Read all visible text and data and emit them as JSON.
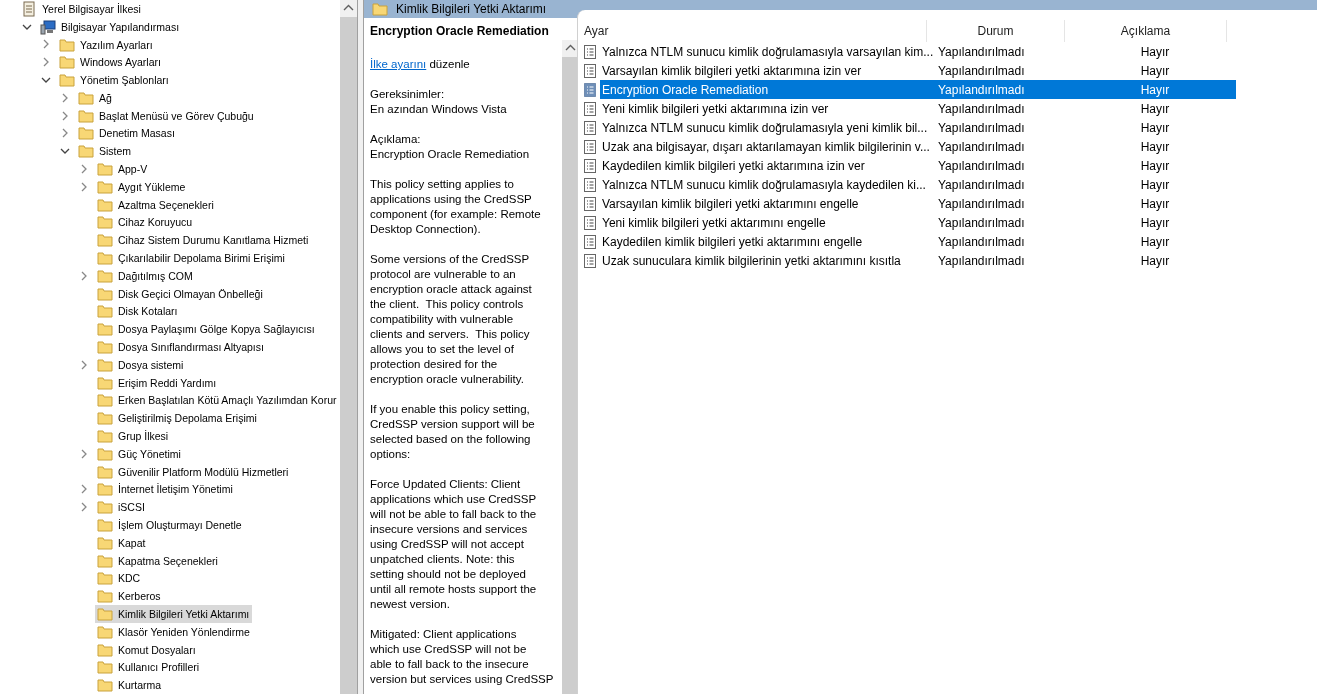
{
  "tree": [
    {
      "label": "Yerel Bilgisayar İlkesi",
      "kind": "policy",
      "selected": false,
      "children": [
        {
          "label": "Bilgisayar Yapılandırması",
          "kind": "computer",
          "expanded": true,
          "selected": false,
          "children": [
            {
              "label": "Yazılım Ayarları",
              "kind": "folder",
              "expanded": false,
              "selected": false
            },
            {
              "label": "Windows Ayarları",
              "kind": "folder",
              "expanded": false,
              "selected": false
            },
            {
              "label": "Yönetim Şablonları",
              "kind": "folder",
              "expanded": true,
              "selected": false,
              "children": [
                {
                  "label": "Ağ",
                  "kind": "folder",
                  "expanded": false,
                  "selected": false
                },
                {
                  "label": "Başlat Menüsü ve Görev Çubuğu",
                  "kind": "folder",
                  "expanded": false,
                  "selected": false
                },
                {
                  "label": "Denetim Masası",
                  "kind": "folder",
                  "expanded": false,
                  "selected": false
                },
                {
                  "label": "Sistem",
                  "kind": "folder",
                  "expanded": true,
                  "selected": false,
                  "children": [
                    {
                      "label": "App-V",
                      "kind": "folder",
                      "expanded": false,
                      "selected": false
                    },
                    {
                      "label": "Aygıt Yükleme",
                      "kind": "folder",
                      "expanded": false,
                      "selected": false
                    },
                    {
                      "label": "Azaltma Seçenekleri",
                      "kind": "folder",
                      "selected": false
                    },
                    {
                      "label": "Cihaz Koruyucu",
                      "kind": "folder",
                      "selected": false
                    },
                    {
                      "label": "Cihaz Sistem Durumu Kanıtlama Hizmeti",
                      "kind": "folder",
                      "selected": false
                    },
                    {
                      "label": "Çıkarılabilir Depolama Birimi Erişimi",
                      "kind": "folder",
                      "selected": false
                    },
                    {
                      "label": "Dağıtılmış COM",
                      "kind": "folder",
                      "expanded": false,
                      "selected": false
                    },
                    {
                      "label": "Disk Geçici Olmayan Önbelleği",
                      "kind": "folder",
                      "selected": false
                    },
                    {
                      "label": "Disk Kotaları",
                      "kind": "folder",
                      "selected": false
                    },
                    {
                      "label": "Dosya Paylaşımı Gölge Kopya Sağlayıcısı",
                      "kind": "folder",
                      "selected": false
                    },
                    {
                      "label": "Dosya Sınıflandırması Altyapısı",
                      "kind": "folder",
                      "selected": false
                    },
                    {
                      "label": "Dosya sistemi",
                      "kind": "folder",
                      "expanded": false,
                      "selected": false
                    },
                    {
                      "label": "Erişim Reddi Yardımı",
                      "kind": "folder",
                      "selected": false
                    },
                    {
                      "label": "Erken Başlatılan Kötü Amaçlı Yazılımdan Korur",
                      "kind": "folder",
                      "selected": false
                    },
                    {
                      "label": "Geliştirilmiş Depolama Erişimi",
                      "kind": "folder",
                      "selected": false
                    },
                    {
                      "label": "Grup İlkesi",
                      "kind": "folder",
                      "selected": false
                    },
                    {
                      "label": "Güç Yönetimi",
                      "kind": "folder",
                      "expanded": false,
                      "selected": false
                    },
                    {
                      "label": "Güvenilir Platform Modülü Hizmetleri",
                      "kind": "folder",
                      "selected": false
                    },
                    {
                      "label": "İnternet İletişim Yönetimi",
                      "kind": "folder",
                      "expanded": false,
                      "selected": false
                    },
                    {
                      "label": "iSCSI",
                      "kind": "folder",
                      "expanded": false,
                      "selected": false
                    },
                    {
                      "label": "İşlem Oluşturmayı Denetle",
                      "kind": "folder",
                      "selected": false
                    },
                    {
                      "label": "Kapat",
                      "kind": "folder",
                      "selected": false
                    },
                    {
                      "label": "Kapatma Seçenekleri",
                      "kind": "folder",
                      "selected": false
                    },
                    {
                      "label": "KDC",
                      "kind": "folder",
                      "selected": false
                    },
                    {
                      "label": "Kerberos",
                      "kind": "folder",
                      "selected": false
                    },
                    {
                      "label": "Kimlik Bilgileri Yetki Aktarımı",
                      "kind": "folder",
                      "selected": true
                    },
                    {
                      "label": "Klasör Yeniden Yönlendirme",
                      "kind": "folder",
                      "selected": false
                    },
                    {
                      "label": "Komut Dosyaları",
                      "kind": "folder",
                      "selected": false
                    },
                    {
                      "label": "Kullanıcı Profilleri",
                      "kind": "folder",
                      "selected": false
                    },
                    {
                      "label": "Kurtarma",
                      "kind": "folder",
                      "selected": false
                    }
                  ]
                }
              ]
            }
          ]
        }
      ]
    }
  ],
  "header": {
    "title": "Kimlik Bilgileri Yetki Aktarımı"
  },
  "details": {
    "title": "Encryption Oracle Remediation",
    "edit": {
      "link": "İlke ayarını",
      "text": "düzenle"
    },
    "sections": [
      {
        "heading": "Gereksinimler:",
        "text": "En azından Windows Vista"
      },
      {
        "heading": "Açıklama:",
        "text": "Encryption Oracle Remediation"
      }
    ],
    "paragraphs": [
      {
        "lines": [
          "This policy setting applies to",
          "applications using the CredSSP",
          "component (for example: Remote",
          "Desktop Connection)."
        ]
      },
      {
        "lines": [
          "Some versions of the CredSSP",
          "protocol are vulnerable to an",
          "encryption oracle attack against",
          "the client.  This policy controls",
          "compatibility with vulnerable",
          "clients and servers.  This policy",
          "allows you to set the level of",
          "protection desired for the",
          "encryption oracle vulnerability."
        ]
      },
      {
        "lines": [
          "If you enable this policy setting,",
          "CredSSP version support will be",
          "selected based on the following",
          "options:"
        ]
      },
      {
        "lines": [
          "Force Updated Clients: Client",
          "applications which use CredSSP",
          "will not be able to fall back to the",
          "insecure versions and services",
          "using CredSSP will not accept",
          "unpatched clients. Note: this",
          "setting should not be deployed",
          "until all remote hosts support the",
          "newest version."
        ]
      },
      {
        "lines": [
          "Mitigated: Client applications",
          "which use CredSSP will not be",
          "able to fall back to the insecure",
          "version but services using CredSSP"
        ]
      }
    ]
  },
  "table": {
    "columns": [
      "Ayar",
      "Durum",
      "Açıklama"
    ],
    "rows": [
      {
        "setting": "Yalnızca NTLM sunucu kimlik doğrulamasıyla varsayılan kim...",
        "state": "Yapılandırılmadı",
        "comment": "Hayır",
        "selected": false
      },
      {
        "setting": "Varsayılan kimlik bilgileri yetki aktarımına izin ver",
        "state": "Yapılandırılmadı",
        "comment": "Hayır",
        "selected": false
      },
      {
        "setting": "Encryption Oracle Remediation",
        "state": "Yapılandırılmadı",
        "comment": "Hayır",
        "selected": true
      },
      {
        "setting": "Yeni kimlik bilgileri yetki aktarımına izin ver",
        "state": "Yapılandırılmadı",
        "comment": "Hayır",
        "selected": false
      },
      {
        "setting": "Yalnızca NTLM sunucu kimlik doğrulamasıyla yeni kimlik bil...",
        "state": "Yapılandırılmadı",
        "comment": "Hayır",
        "selected": false
      },
      {
        "setting": "Uzak ana bilgisayar, dışarı aktarılamayan kimlik bilgilerinin v...",
        "state": "Yapılandırılmadı",
        "comment": "Hayır",
        "selected": false
      },
      {
        "setting": "Kaydedilen kimlik bilgileri yetki aktarımına izin ver",
        "state": "Yapılandırılmadı",
        "comment": "Hayır",
        "selected": false
      },
      {
        "setting": "Yalnızca NTLM sunucu kimlik doğrulamasıyla kaydedilen ki...",
        "state": "Yapılandırılmadı",
        "comment": "Hayır",
        "selected": false
      },
      {
        "setting": "Varsayılan kimlik bilgileri yetki aktarımını engelle",
        "state": "Yapılandırılmadı",
        "comment": "Hayır",
        "selected": false
      },
      {
        "setting": "Yeni kimlik bilgileri yetki aktarımını engelle",
        "state": "Yapılandırılmadı",
        "comment": "Hayır",
        "selected": false
      },
      {
        "setting": "Kaydedilen kimlik bilgileri yetki aktarımını engelle",
        "state": "Yapılandırılmadı",
        "comment": "Hayır",
        "selected": false
      },
      {
        "setting": "Uzak sunuculara kimlik bilgilerinin yetki aktarımını kısıtla",
        "state": "Yapılandırılmadı",
        "comment": "Hayır",
        "selected": false
      }
    ]
  }
}
